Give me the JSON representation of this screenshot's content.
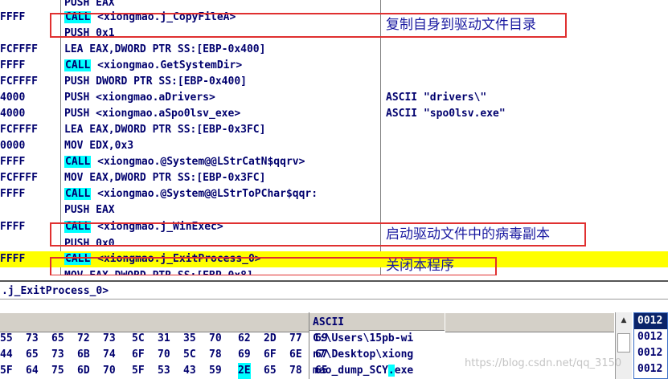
{
  "disasm": {
    "rows": [
      {
        "addr": "",
        "pre": "PUSH EAX",
        "call": "",
        "post": "",
        "comment": ""
      },
      {
        "addr": "FFFF",
        "pre": "",
        "call": "CALL",
        "post": " <xiongmao.j_CopyFileA>",
        "comment": ""
      },
      {
        "addr": "",
        "pre": "PUSH 0x1",
        "call": "",
        "post": "",
        "comment": ""
      },
      {
        "addr": "FCFFFF",
        "pre": "LEA EAX,DWORD PTR SS:[EBP-0x400]",
        "call": "",
        "post": "",
        "comment": ""
      },
      {
        "addr": "FFFF",
        "pre": "",
        "call": "CALL",
        "post": " <xiongmao.GetSystemDir>",
        "comment": ""
      },
      {
        "addr": "FCFFFF",
        "pre": "PUSH DWORD PTR SS:[EBP-0x400]",
        "call": "",
        "post": "",
        "comment": ""
      },
      {
        "addr": "4000",
        "pre": "PUSH <xiongmao.aDrivers>",
        "call": "",
        "post": "",
        "comment": "ASCII \"drivers\\\""
      },
      {
        "addr": "4000",
        "pre": "PUSH <xiongmao.aSpo0lsv_exe>",
        "call": "",
        "post": "",
        "comment": "ASCII \"spo0lsv.exe\""
      },
      {
        "addr": "FCFFFF",
        "pre": "LEA EAX,DWORD PTR SS:[EBP-0x3FC]",
        "call": "",
        "post": "",
        "comment": ""
      },
      {
        "addr": "0000",
        "pre": "MOV EDX,0x3",
        "call": "",
        "post": "",
        "comment": ""
      },
      {
        "addr": "FFFF",
        "pre": "",
        "call": "CALL",
        "post": " <xiongmao.@System@@LStrCatN$qqrv>",
        "comment": ""
      },
      {
        "addr": "FCFFFF",
        "pre": "MOV EAX,DWORD PTR SS:[EBP-0x3FC]",
        "call": "",
        "post": "",
        "comment": ""
      },
      {
        "addr": "FFFF",
        "pre": "",
        "call": "CALL",
        "post": " <xiongmao.@System@@LStrToPChar$qqr:",
        "comment": ""
      },
      {
        "addr": "",
        "pre": "PUSH EAX",
        "call": "",
        "post": "",
        "comment": ""
      },
      {
        "addr": "FFFF",
        "pre": "",
        "call": "CALL",
        "post": " <xiongmao.j_WinExec>",
        "comment": ""
      },
      {
        "addr": "",
        "pre": "PUSH 0x0",
        "call": "",
        "post": "",
        "comment": ""
      },
      {
        "addr": "FFFF",
        "pre": "",
        "call": "CALL",
        "post": " <xiongmao.j_ExitProcess_0>",
        "comment": ""
      },
      {
        "addr": "",
        "pre": "MOV EAX,DWORD PTR SS:[EBP-0x8]",
        "call": "",
        "post": "",
        "comment": ""
      }
    ],
    "selected_index": 16
  },
  "annotations": {
    "copy_self": "复制自身到驱动文件目录",
    "run_copy": "启动驱动文件中的病毒副本",
    "close_self": "关闭本程序"
  },
  "info_bar": ".j_ExitProcess_0>",
  "dump": {
    "ascii_header": "ASCII",
    "rows": [
      {
        "hex": [
          "55",
          "73",
          "65",
          "72",
          "73",
          "5C",
          "31",
          "35",
          "70",
          "62",
          "2D",
          "77",
          "69"
        ],
        "ascii_pre": "C:\\Users\\15pb-wi",
        "ascii_hl": "",
        "ascii_post": ""
      },
      {
        "hex": [
          "44",
          "65",
          "73",
          "6B",
          "74",
          "6F",
          "70",
          "5C",
          "78",
          "69",
          "6F",
          "6E",
          "67"
        ],
        "ascii_pre": "n7\\Desktop\\xiong",
        "ascii_hl": "",
        "ascii_post": ""
      },
      {
        "hex": [
          "5F",
          "64",
          "75",
          "6D",
          "70",
          "5F",
          "53",
          "43",
          "59",
          "2E",
          "65",
          "78",
          "65"
        ],
        "ascii_pre": "mao_dump_SCY",
        "ascii_hl": ".",
        "ascii_post": "exe"
      }
    ],
    "highlight": {
      "row": 2,
      "col": 9
    }
  },
  "stack": {
    "rows": [
      "0012",
      "0012",
      "0012",
      "0012"
    ]
  },
  "watermark": "https://blog.csdn.net/qq_3150",
  "colors": {
    "text": "#00006e",
    "call_bg": "#00ffff",
    "selected_row": "#ffff00",
    "box": "#e03030",
    "annotation": "#1a1aa0"
  }
}
